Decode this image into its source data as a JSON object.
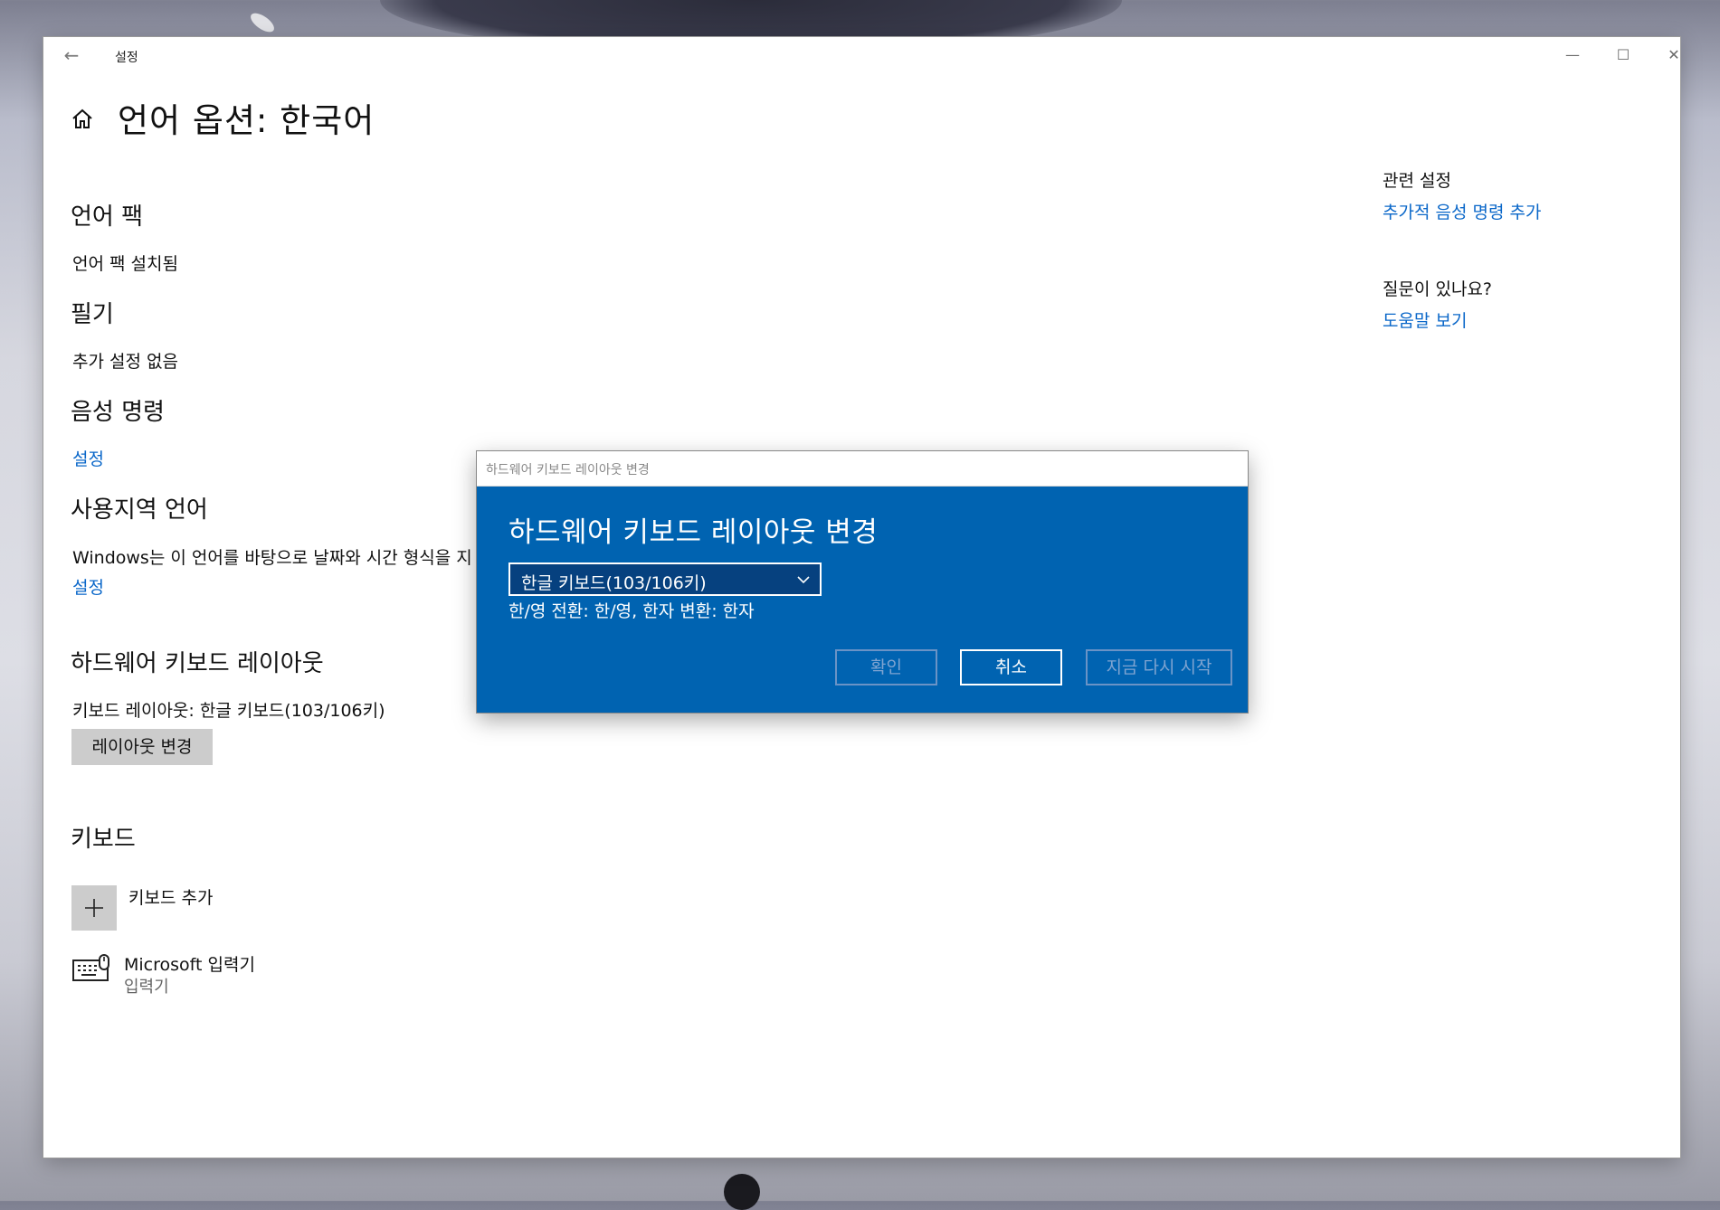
{
  "window": {
    "title": "설정",
    "back_glyph": "←",
    "controls": {
      "minimize": "—",
      "maximize": "☐",
      "close": "✕"
    }
  },
  "page": {
    "title": "언어 옵션: 한국어",
    "home_icon": "home-icon"
  },
  "sections": {
    "language_pack": {
      "heading": "언어 팩",
      "status": "언어 팩 설치됨"
    },
    "handwriting": {
      "heading": "필기",
      "status": "추가 설정 없음"
    },
    "speech": {
      "heading": "음성 명령",
      "link": "설정"
    },
    "regional": {
      "heading": "사용지역 언어",
      "text": "Windows는 이 언어를 바탕으로 날짜와 시간 형식을 지",
      "link": "설정"
    },
    "hw_keyboard": {
      "heading": "하드웨어 키보드 레이아웃",
      "current": "키보드 레이아웃: 한글 키보드(103/106키)",
      "button": "레이아웃 변경"
    },
    "keyboards": {
      "heading": "키보드",
      "add_label": "키보드 추가",
      "ime_name": "Microsoft 입력기",
      "ime_sub": "입력기"
    }
  },
  "sidebar": {
    "related_title": "관련 설정",
    "related_link": "추가적 음성 명령 추가",
    "question_title": "질문이 있나요?",
    "help_link": "도움말 보기"
  },
  "dialog": {
    "title": "하드웨어 키보드 레이아웃 변경",
    "heading": "하드웨어 키보드 레이아웃 변경",
    "select_value": "한글 키보드(103/106키)",
    "info": "한/영 전환: 한/영, 한자 변환: 한자",
    "buttons": {
      "ok": "확인",
      "cancel": "취소",
      "restart": "지금 다시 시작"
    }
  },
  "colors": {
    "accent": "#0063b1",
    "link": "#0a67c9",
    "button_gray": "#cccccc"
  }
}
